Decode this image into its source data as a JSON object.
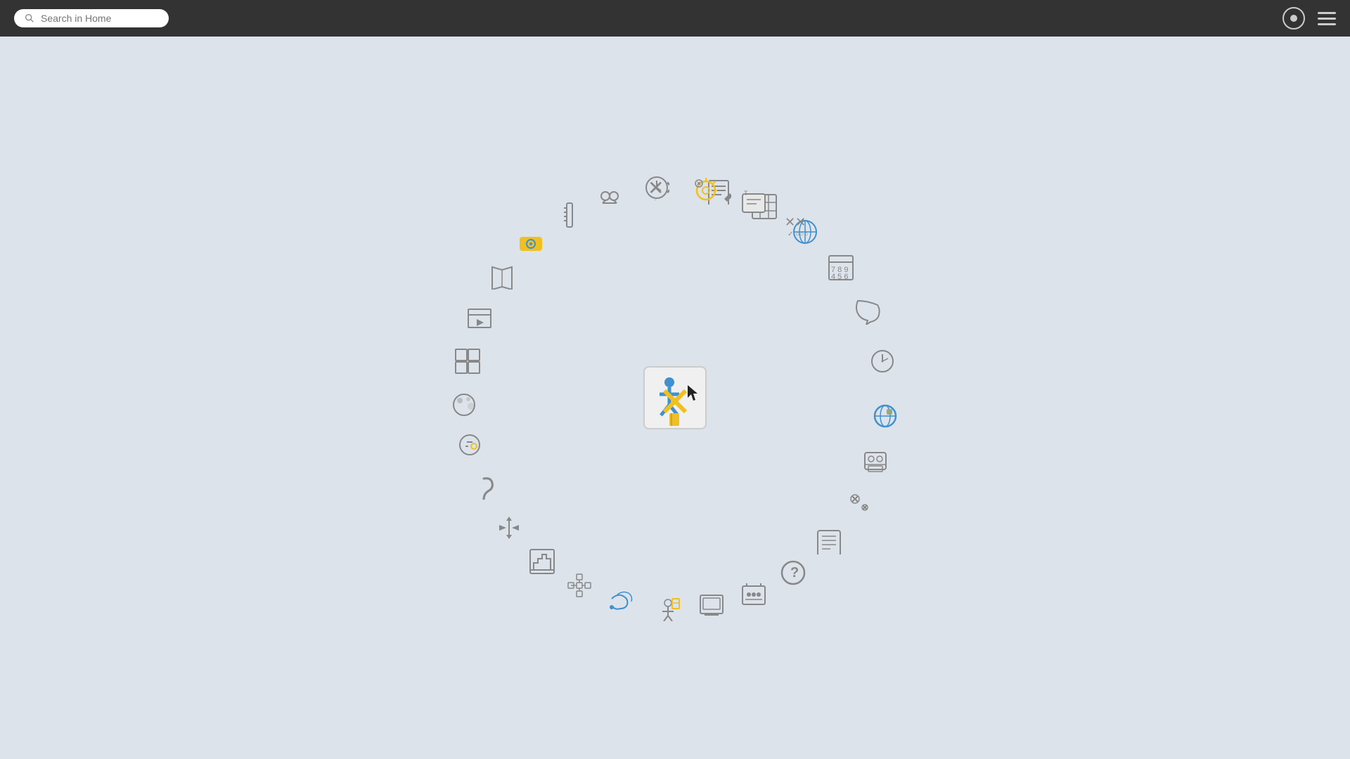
{
  "topbar": {
    "search_placeholder": "Search in Home",
    "record_button_label": "Record",
    "menu_button_label": "Menu"
  },
  "circle": {
    "center_icon": "app-center-icon",
    "radius": 300,
    "icons": [
      {
        "id": "close-xx-icon",
        "angle": -80,
        "label": "Close/Delete"
      },
      {
        "id": "edit-doc-icon",
        "angle": -70,
        "label": "Edit Document"
      },
      {
        "id": "grid-icon",
        "angle": -60,
        "label": "Grid"
      },
      {
        "id": "globe-icon",
        "angle": -50,
        "label": "Globe"
      },
      {
        "id": "calculator-icon",
        "angle": -40,
        "label": "Calculator"
      },
      {
        "id": "chat-icon",
        "angle": -30,
        "label": "Chat"
      },
      {
        "id": "clock-icon",
        "angle": -20,
        "label": "Clock"
      },
      {
        "id": "world-icon",
        "angle": -10,
        "label": "World"
      },
      {
        "id": "contacts-icon",
        "angle": 0,
        "label": "Contacts"
      },
      {
        "id": "speech-cancel-icon",
        "angle": 10,
        "label": "Speech Cancel"
      },
      {
        "id": "notebook-icon",
        "angle": 20,
        "label": "Notebook"
      },
      {
        "id": "help-icon",
        "angle": 30,
        "label": "Help"
      },
      {
        "id": "meeting-icon",
        "angle": 40,
        "label": "Meeting"
      },
      {
        "id": "picture-icon",
        "angle": 50,
        "label": "Picture"
      },
      {
        "id": "person-flag-icon",
        "angle": 60,
        "label": "Person Flag"
      },
      {
        "id": "music-icon",
        "angle": 70,
        "label": "Music"
      },
      {
        "id": "network-icon",
        "angle": 80,
        "label": "Network"
      },
      {
        "id": "maze-icon",
        "angle": 90,
        "label": "Maze"
      },
      {
        "id": "balance-icon",
        "angle": 100,
        "label": "Balance Scale"
      },
      {
        "id": "snake-icon",
        "angle": 110,
        "label": "Snake"
      },
      {
        "id": "cursor-ball-icon",
        "angle": 120,
        "label": "Cursor Ball"
      },
      {
        "id": "moon-icon",
        "angle": 130,
        "label": "Moon"
      },
      {
        "id": "tiles-icon",
        "angle": 140,
        "label": "Tiles"
      },
      {
        "id": "presentation-icon",
        "angle": 150,
        "label": "Presentation"
      },
      {
        "id": "book-icon",
        "angle": 160,
        "label": "Book"
      },
      {
        "id": "eye-icon",
        "angle": 170,
        "label": "Eye"
      },
      {
        "id": "ruler-icon",
        "angle": 180,
        "label": "Ruler"
      },
      {
        "id": "eyes-icon",
        "angle": 190,
        "label": "Eyes"
      },
      {
        "id": "clock2-icon",
        "angle": 200,
        "label": "Clock 2"
      },
      {
        "id": "gear-turtle-icon",
        "angle": 210,
        "label": "Gear Turtle"
      },
      {
        "id": "text-box-icon",
        "angle": 220,
        "label": "Text Box"
      },
      {
        "id": "symbols-icon",
        "angle": 230,
        "label": "Symbols"
      }
    ]
  }
}
